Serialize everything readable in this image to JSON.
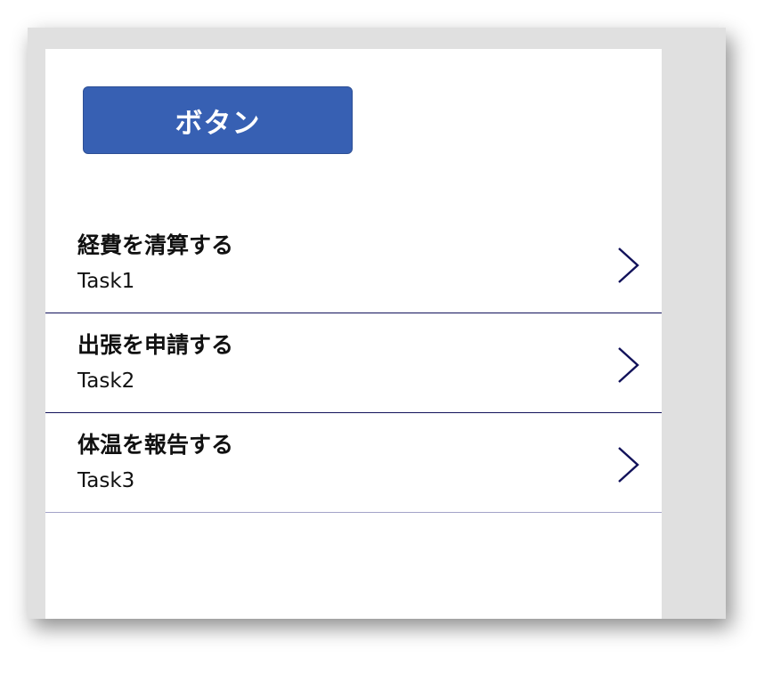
{
  "button": {
    "label": "ボタン",
    "color": "#3760b3"
  },
  "list": {
    "items": [
      {
        "title": "経費を清算する",
        "subtitle": "Task1",
        "icon": "chevron-right-icon"
      },
      {
        "title": "出張を申請する",
        "subtitle": "Task2",
        "icon": "chevron-right-icon"
      },
      {
        "title": "体温を報告する",
        "subtitle": "Task3",
        "icon": "chevron-right-icon"
      }
    ],
    "separator_color": "#12125a",
    "chevron_color": "#12125a"
  }
}
